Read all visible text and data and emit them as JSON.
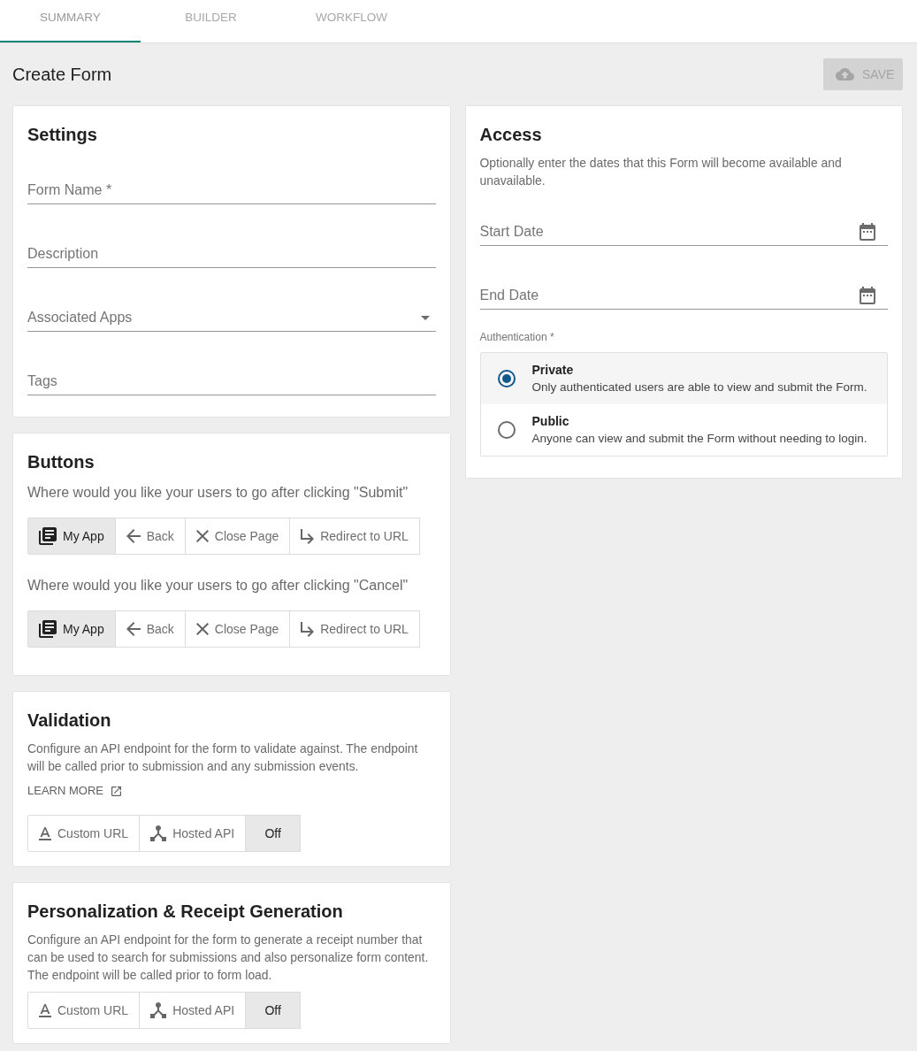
{
  "tabs": [
    {
      "label": "SUMMARY",
      "selected": true
    },
    {
      "label": "BUILDER",
      "selected": false
    },
    {
      "label": "WORKFLOW",
      "selected": false
    }
  ],
  "header": {
    "title": "Create Form",
    "save_button": {
      "label": "SAVE",
      "disabled": true
    }
  },
  "settings": {
    "title": "Settings",
    "fields": [
      {
        "kind": "text",
        "placeholder": "Form Name *"
      },
      {
        "kind": "text",
        "placeholder": "Description"
      },
      {
        "kind": "select",
        "placeholder": "Associated Apps"
      },
      {
        "kind": "text",
        "placeholder": "Tags"
      }
    ]
  },
  "buttons": {
    "title": "Buttons",
    "groups": [
      {
        "prompt": "Where would you like your users to go after clicking \"Submit\"",
        "options": [
          {
            "kind": "app",
            "label": "My App",
            "selected": true
          },
          {
            "kind": "back",
            "label": "Back",
            "selected": false
          },
          {
            "kind": "close",
            "label": "Close Page",
            "selected": false
          },
          {
            "kind": "redirect",
            "label": "Redirect to URL",
            "selected": false
          }
        ]
      },
      {
        "prompt": "Where would you like your users to go after clicking \"Cancel\"",
        "options": [
          {
            "kind": "app",
            "label": "My App",
            "selected": true
          },
          {
            "kind": "back",
            "label": "Back",
            "selected": false
          },
          {
            "kind": "close",
            "label": "Close Page",
            "selected": false
          },
          {
            "kind": "redirect",
            "label": "Redirect to URL",
            "selected": false
          }
        ]
      }
    ]
  },
  "validation": {
    "title": "Validation",
    "description": "Configure an API endpoint for the form to validate against. The endpoint will be called prior to submission and any submission events.",
    "link": {
      "label": "LEARN MORE"
    },
    "options": [
      {
        "kind": "url",
        "label": "Custom URL",
        "selected": false
      },
      {
        "kind": "api",
        "label": "Hosted API",
        "selected": false
      },
      {
        "kind": "off",
        "label": "Off",
        "selected": true
      }
    ]
  },
  "personalization": {
    "title": "Personalization & Receipt Generation",
    "description": "Configure an API endpoint for the form to generate a receipt number that can be used to search for submissions and also personalize form content. The endpoint will be called prior to form load.",
    "options": [
      {
        "kind": "url",
        "label": "Custom URL",
        "selected": false
      },
      {
        "kind": "api",
        "label": "Hosted API",
        "selected": false
      },
      {
        "kind": "off",
        "label": "Off",
        "selected": true
      }
    ]
  },
  "access": {
    "title": "Access",
    "description": "Optionally enter the dates that this Form will become available and unavailable.",
    "fields": [
      {
        "kind": "date",
        "placeholder": "Start Date"
      },
      {
        "kind": "date",
        "placeholder": "End Date"
      }
    ],
    "authentication": {
      "label": "Authentication *",
      "options": [
        {
          "label": "Private",
          "description": "Only authenticated users are able to view and submit the Form.",
          "selected": true
        },
        {
          "label": "Public",
          "description": "Anyone can view and submit the Form without needing to login.",
          "selected": false
        }
      ]
    }
  }
}
